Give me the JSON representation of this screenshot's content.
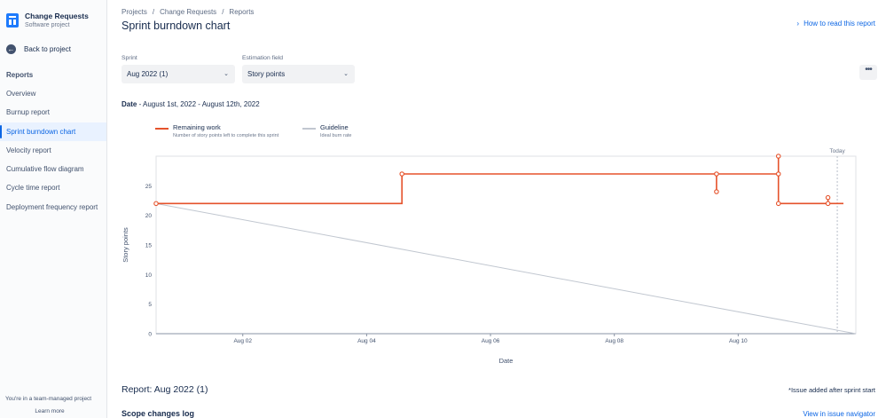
{
  "sidebar": {
    "project_name": "Change Requests",
    "project_type": "Software project",
    "back_label": "Back to project",
    "section_heading": "Reports",
    "items": [
      {
        "label": "Overview"
      },
      {
        "label": "Burnup report"
      },
      {
        "label": "Sprint burndown chart",
        "active": true
      },
      {
        "label": "Velocity report"
      },
      {
        "label": "Cumulative flow diagram"
      },
      {
        "label": "Cycle time report"
      },
      {
        "label": "Deployment frequency report"
      }
    ],
    "team_note": "You're in a team-managed project",
    "learn_more": "Learn more"
  },
  "breadcrumb": [
    "Projects",
    "Change Requests",
    "Reports"
  ],
  "page_title": "Sprint burndown chart",
  "how_to_read": "How to read this report",
  "filters": {
    "sprint_label": "Sprint",
    "sprint_value": "Aug 2022 (1)",
    "estimation_label": "Estimation field",
    "estimation_value": "Story points"
  },
  "more_label": "•••",
  "date_label": "Date",
  "date_range": " - August 1st, 2022 - August 12th, 2022",
  "legend": [
    {
      "name": "Remaining work",
      "desc": "Number of story points left to complete this sprint",
      "color": "#e5522b"
    },
    {
      "name": "Guideline",
      "desc": "Ideal burn rate",
      "color": "#c1c7d0"
    }
  ],
  "chart_data": {
    "type": "line",
    "xlabel": "Date",
    "ylabel": "Story points",
    "xlim": [
      0,
      11.3
    ],
    "ylim": [
      0,
      30
    ],
    "yticks": [
      0,
      5,
      10,
      15,
      20,
      25
    ],
    "xticks": [
      {
        "label": "Aug 02",
        "x": 1.4
      },
      {
        "label": "Aug 04",
        "x": 3.4
      },
      {
        "label": "Aug 06",
        "x": 5.4
      },
      {
        "label": "Aug 08",
        "x": 7.4
      },
      {
        "label": "Aug 10",
        "x": 9.4
      }
    ],
    "today_label": "Today",
    "today_x": 11.0,
    "series": [
      {
        "name": "Remaining work",
        "color": "#e5522b",
        "step": [
          [
            0,
            22
          ],
          [
            3.97,
            22
          ],
          [
            3.97,
            27
          ],
          [
            9.05,
            27
          ],
          [
            9.05,
            24
          ],
          [
            9.05,
            27
          ],
          [
            10.05,
            27
          ],
          [
            10.05,
            30
          ],
          [
            10.05,
            22
          ],
          [
            10.85,
            22
          ],
          [
            10.85,
            23
          ],
          [
            10.85,
            22
          ],
          [
            11.1,
            22
          ]
        ],
        "points": [
          [
            0,
            22
          ],
          [
            3.97,
            27
          ],
          [
            9.05,
            27
          ],
          [
            9.05,
            24
          ],
          [
            10.05,
            27
          ],
          [
            10.05,
            30
          ],
          [
            10.05,
            22
          ],
          [
            10.85,
            23
          ],
          [
            10.85,
            22
          ]
        ]
      },
      {
        "name": "Guideline",
        "color": "#c1c7d0",
        "line": [
          [
            0,
            22
          ],
          [
            11.3,
            0
          ]
        ]
      }
    ]
  },
  "report": {
    "title": "Report: Aug 2022 (1)",
    "issue_note": "*Issue added after sprint start",
    "scope_log": "Scope changes log",
    "view_navigator": "View in issue navigator"
  }
}
